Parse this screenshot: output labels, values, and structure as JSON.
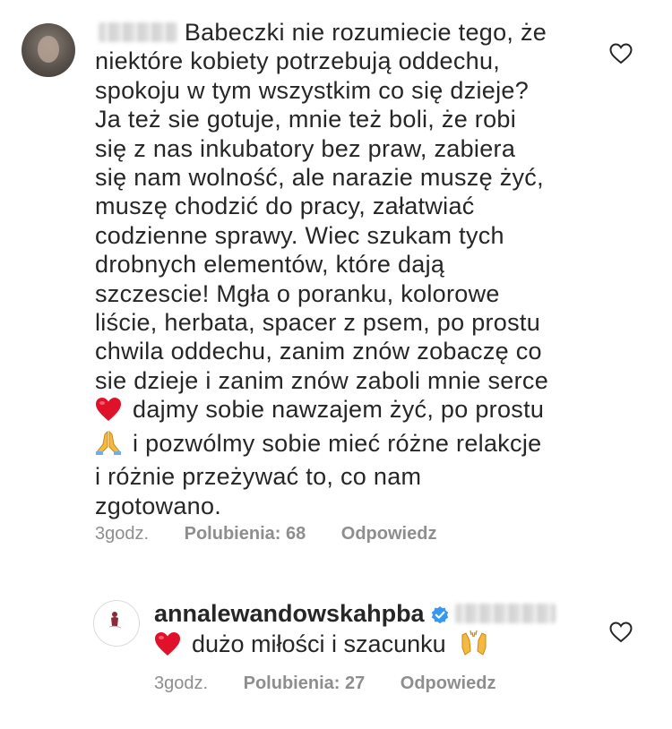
{
  "comments": [
    {
      "lines": [
        "Babeczki nie rozumiecie tego, że",
        "niektóre kobiety potrzebują oddechu,",
        "spokoju w tym wszystkim co się dzieje?",
        "Ja też sie gotuje, mnie też boli, że robi",
        "się z nas inkubatory bez praw, zabiera",
        "się nam wolność, ale narazie muszę żyć,",
        "muszę chodzić do pracy, załatwiać",
        "codzienne sprawy. Wiec szukam tych",
        "drobnych elementów, które dają",
        "szczescie! Mgła o poranku, kolorowe",
        "liście, herbata, spacer z psem, po prostu",
        "chwila oddechu, zanim znów zobaczę co",
        "sie dzieje i zanim znów zaboli mnie serce",
        "dajmy sobie nawzajem żyć, po prostu",
        "i pozwólmy sobie mieć różne relakcje",
        "i różnie przeżywać to, co nam",
        "zgotowano."
      ],
      "emoji_line_13": "red-heart-emoji",
      "emoji_line_14": "folded-hands-emoji",
      "time": "3godz.",
      "likes": "Polubienia: 68",
      "reply": "Odpowiedz"
    },
    {
      "username": "annalewandowskahpba",
      "text": "dużo miłości i szacunku",
      "emoji_before": "red-heart-emoji",
      "emoji_after": "raising-hands-emoji",
      "time": "3godz.",
      "likes": "Polubienia: 27",
      "reply": "Odpowiedz"
    }
  ],
  "icons": {
    "like": "heart-outline-icon",
    "verified": "verified-badge-icon"
  },
  "colors": {
    "text": "#262626",
    "meta": "#8e8e8e",
    "verified": "#3897f0",
    "heart_emoji": "#e0112b"
  }
}
